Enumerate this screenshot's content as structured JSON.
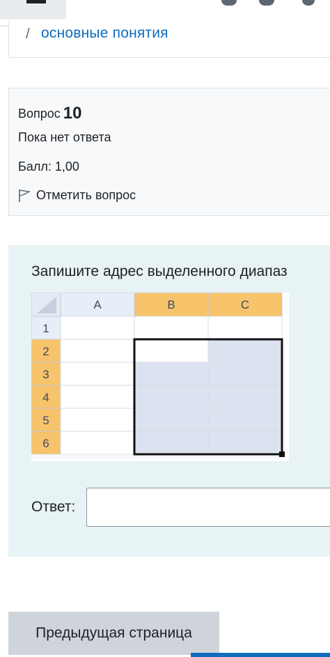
{
  "breadcrumb": {
    "separator": "/",
    "link_text": "основные понятия"
  },
  "question_info": {
    "label": "Вопрос",
    "number": "10",
    "state": "Пока нет ответа",
    "grade": "Балл: 1,00",
    "flag_label": "Отметить вопрос"
  },
  "question": {
    "text": "Запишите адрес выделенного диапаз",
    "answer_label": "Ответ:",
    "answer_value": ""
  },
  "spreadsheet": {
    "columns": [
      "A",
      "B",
      "C"
    ],
    "rows": [
      "1",
      "2",
      "3",
      "4",
      "5",
      "6"
    ],
    "selected_columns": [
      "B",
      "C"
    ],
    "selected_rows": [
      "2",
      "3",
      "4",
      "5",
      "6"
    ]
  },
  "navigation": {
    "prev_label": "Предыдущая страница"
  },
  "colors": {
    "link": "#0f6cbf",
    "selection_fill": "#dde2f0",
    "header_highlight": "#f7c36b",
    "panel_bg": "#e7f3f5"
  }
}
